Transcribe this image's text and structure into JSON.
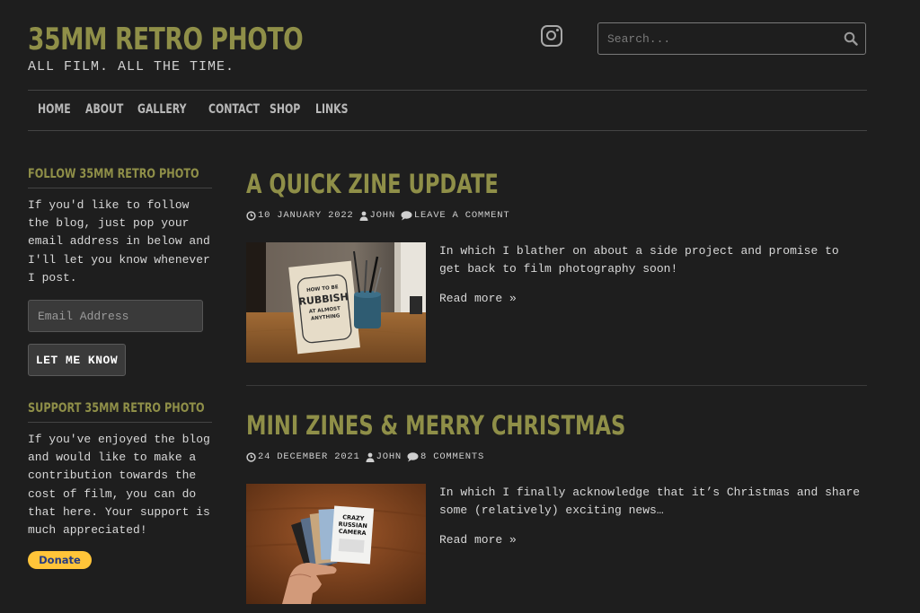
{
  "site": {
    "title": "35MM RETRO PHOTO",
    "tagline": "ALL FILM. ALL THE TIME."
  },
  "search": {
    "placeholder": "Search..."
  },
  "nav": [
    "HOME",
    "ABOUT",
    "GALLERY",
    "CONTACT",
    "SHOP",
    "LINKS"
  ],
  "sidebar": {
    "follow": {
      "title": "FOLLOW 35MM RETRO PHOTO",
      "text": "If you'd like to follow the blog, just pop your email address in below and I'll let you know whenever I post.",
      "email_placeholder": "Email Address",
      "button": "LET ME KNOW"
    },
    "support": {
      "title": "SUPPORT 35MM RETRO PHOTO",
      "text": "If you've enjoyed the blog and would like to make a contribution towards the cost of film, you can do that here. Your support is much appreciated!",
      "donate": "Donate"
    }
  },
  "posts": [
    {
      "title": "A QUICK ZINE UPDATE",
      "date": "10 JANUARY 2022",
      "author": "JOHN",
      "comments": "LEAVE A COMMENT",
      "excerpt": "In which I blather on about a side project and promise to get back to film photography soon!",
      "read_more": "Read more »",
      "image_text": [
        "HOW TO BE",
        "RUBBISH",
        "AT ALMOST",
        "ANYTHING"
      ]
    },
    {
      "title": "MINI ZINES & MERRY CHRISTMAS",
      "date": "24 DECEMBER 2021",
      "author": "JOHN",
      "comments": "8 COMMENTS",
      "excerpt": "In which I finally acknowledge that it’s Christmas and share some (relatively) exciting news…",
      "read_more": "Read more »",
      "image_text": [
        "CRAZY",
        "RUSSIAN",
        "CAMERA"
      ]
    }
  ],
  "colors": {
    "accent": "#8f8f48",
    "background": "#1e1e1e",
    "donate": "#ffc439"
  }
}
